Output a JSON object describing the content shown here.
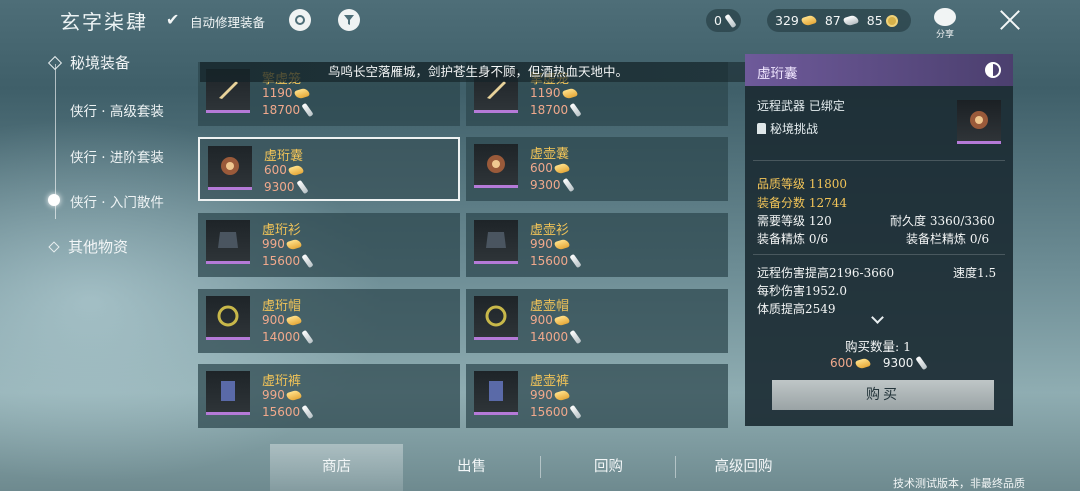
{
  "topbar": {
    "title": "玄字柒肆",
    "auto_repair_check": "✔",
    "auto_repair_label": "自动修理装备",
    "currency": {
      "c0": "0",
      "c1": "329",
      "c2": "87",
      "c3": "85"
    },
    "share_label": "分享"
  },
  "nav": {
    "cat1": "秘境装备",
    "sub1": "侠行 · 高级套装",
    "sub2": "侠行 · 进阶套装",
    "sub3": "侠行 · 入门散件",
    "cat2": "其他物资"
  },
  "banner": "鸟鸣长空落雁城，剑护苍生身不顾，但酒热血天地中。",
  "items": [
    {
      "name": "擎虚笼",
      "price_gold": "1190",
      "price_blade": "18700"
    },
    {
      "name": "擎虚笼",
      "price_gold": "1190",
      "price_blade": "18700"
    },
    {
      "name": "虚珩囊",
      "price_gold": "600",
      "price_blade": "9300"
    },
    {
      "name": "虚壶囊",
      "price_gold": "600",
      "price_blade": "9300"
    },
    {
      "name": "虚珩衫",
      "price_gold": "990",
      "price_blade": "15600"
    },
    {
      "name": "虚壶衫",
      "price_gold": "990",
      "price_blade": "15600"
    },
    {
      "name": "虚珩帽",
      "price_gold": "900",
      "price_blade": "14000"
    },
    {
      "name": "虚壶帽",
      "price_gold": "900",
      "price_blade": "14000"
    },
    {
      "name": "虚珩裤",
      "price_gold": "990",
      "price_blade": "15600"
    },
    {
      "name": "虚壶裤",
      "price_gold": "990",
      "price_blade": "15600"
    }
  ],
  "detail": {
    "title": "虚珩囊",
    "type": "远程武器  已绑定",
    "source": "秘境挑战",
    "quality_label": "品质等级",
    "quality_value": "11800",
    "score_label": "装备分数",
    "score_value": "12744",
    "req_level": "需要等级 120",
    "durability": "耐久度 3360/3360",
    "refine": "装备精炼 0/6",
    "slot_refine": "装备栏精炼 0/6",
    "attr1": "远程伤害提高2196-3660",
    "speed": "速度1.5",
    "attr2": "每秒伤害1952.0",
    "attr3": "体质提高2549",
    "buy_qty": "购买数量: 1",
    "cost_gold": "600",
    "cost_blade": "9300",
    "buy_button": "购买"
  },
  "tabs": {
    "t1": "商店",
    "t2": "出售",
    "t3": "回购",
    "t4": "高级回购"
  },
  "footer": "技术测试版本，非最终品质"
}
